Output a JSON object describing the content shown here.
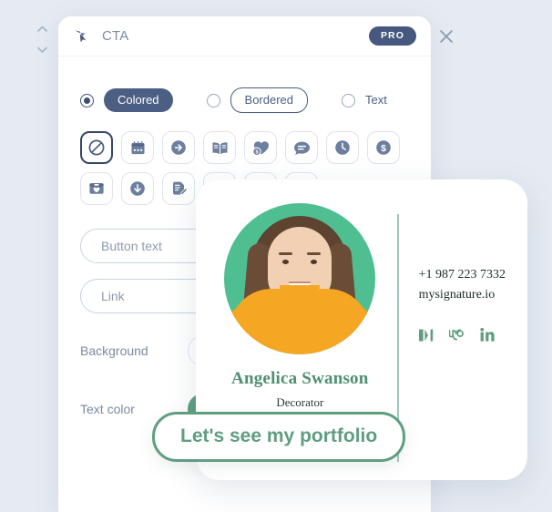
{
  "window": {
    "title": "CTA",
    "badge": "PRO",
    "close_label": "×",
    "cursor_icon": "cursor-click-icon",
    "drag_handle_icon": "up-down-chevron-icon"
  },
  "style_options": [
    {
      "label": "Colored",
      "style": "filled",
      "selected": true
    },
    {
      "label": "Bordered",
      "style": "outlined",
      "selected": false
    },
    {
      "label": "Text",
      "style": "plain",
      "selected": false
    }
  ],
  "icons": [
    {
      "name": "no-icon",
      "selected": true
    },
    {
      "name": "calendar-icon",
      "selected": false
    },
    {
      "name": "arrow-right-icon",
      "selected": false
    },
    {
      "name": "book-icon",
      "selected": false
    },
    {
      "name": "heart-dollar-icon",
      "selected": false
    },
    {
      "name": "chat-bubble-icon",
      "selected": false
    },
    {
      "name": "clock-icon",
      "selected": false
    },
    {
      "name": "dollar-icon",
      "selected": false
    },
    {
      "name": "gift-box-icon",
      "selected": false
    },
    {
      "name": "download-icon",
      "selected": false
    },
    {
      "name": "sign-document-icon",
      "selected": false
    },
    {
      "name": "user-icon",
      "selected": false
    },
    {
      "name": "discount-tag-icon",
      "selected": false
    },
    {
      "name": "search-icon",
      "selected": false
    }
  ],
  "fields": {
    "button_text_placeholder": "Button text",
    "button_text_value": "",
    "link_placeholder": "Link",
    "link_value": ""
  },
  "color_settings": [
    {
      "label": "Background",
      "value": "#ffffff"
    },
    {
      "label": "Text color",
      "value": "#4e8f73"
    }
  ],
  "signature": {
    "name": "Angelica Swanson",
    "role": "Decorator",
    "phone": "+1 987 223 7332",
    "website": "mysignature.io",
    "cta_label": "Let's see my portfolio",
    "accent_color": "#5f9e7f",
    "avatar_bg": "#4fbf91",
    "socials": [
      {
        "name": "medium-icon"
      },
      {
        "name": "upwork-icon"
      },
      {
        "name": "linkedin-icon"
      }
    ]
  }
}
